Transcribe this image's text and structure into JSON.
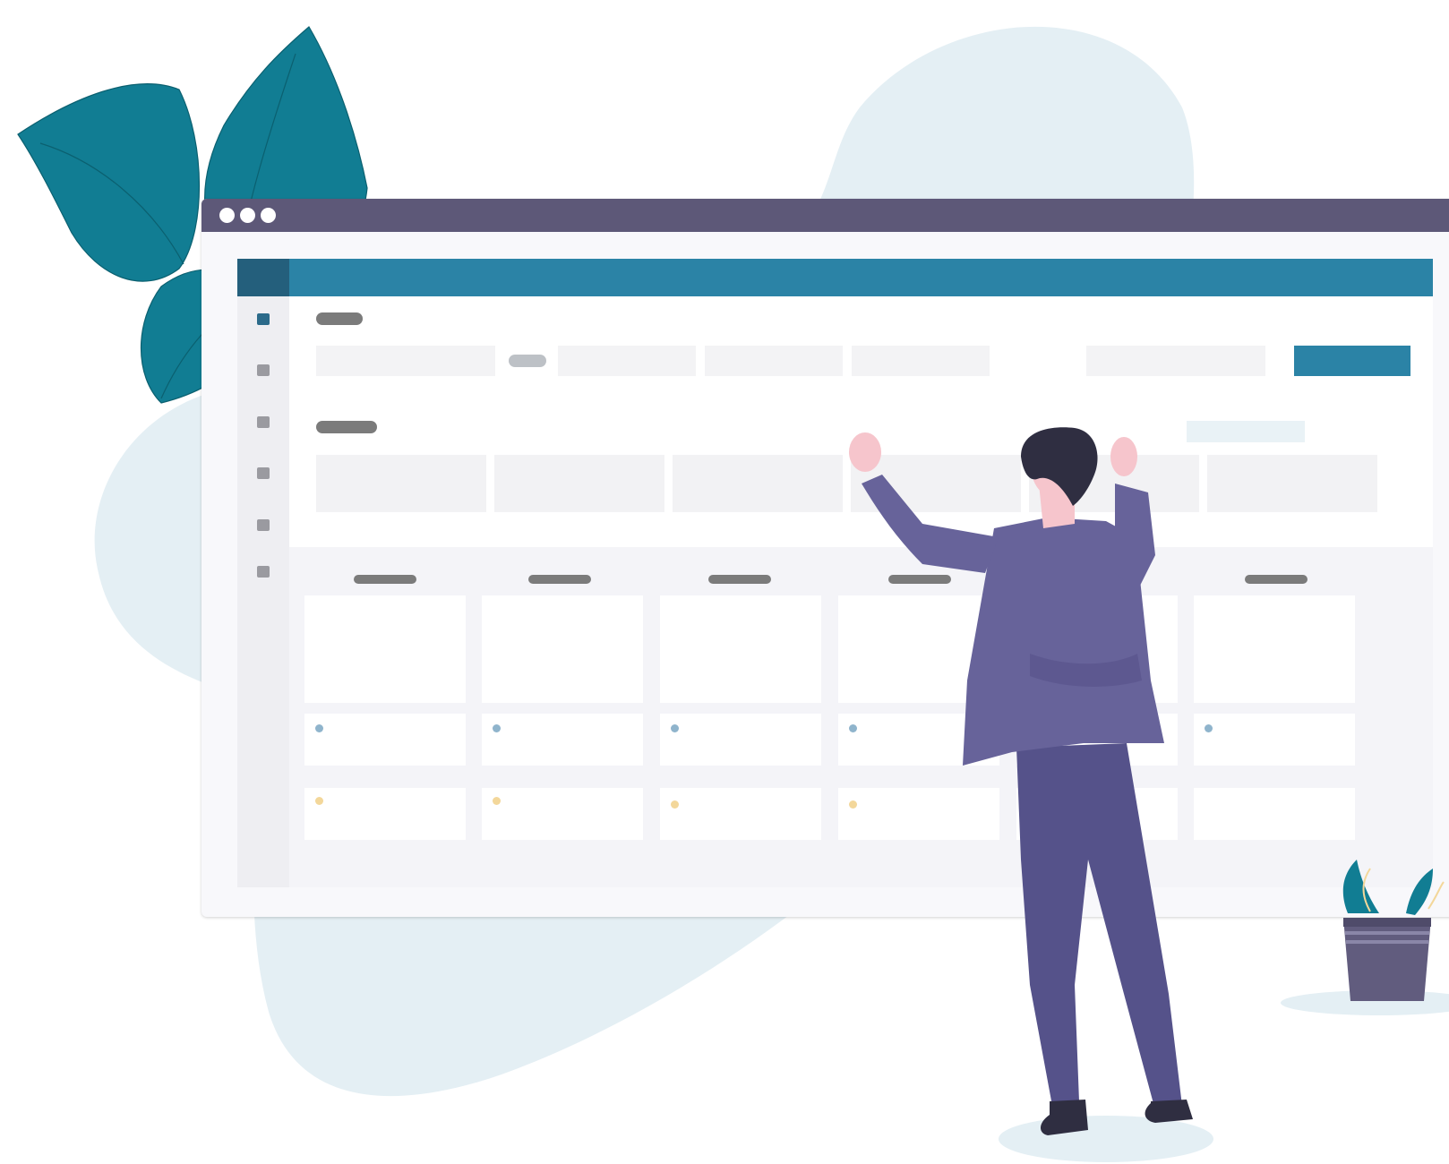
{
  "window": {
    "title_bar_dots": 3,
    "sidebar_icons": 6,
    "active_sidebar_index": 0,
    "columns": 6
  },
  "colors": {
    "title_bar": "#5d5878",
    "header": "#2b83a6",
    "accent_dark": "#245f7c",
    "leaf": "#117d93",
    "blob": "#e4eff4",
    "suit": "#5d5a8a",
    "hair": "#2f2e41",
    "skin": "#f6c5cc",
    "blue_marker": "#8fb4cc",
    "yellow_marker": "#f3d79a"
  },
  "icons": [
    "leaf-icon",
    "plant-pot-icon",
    "person-illustration"
  ]
}
